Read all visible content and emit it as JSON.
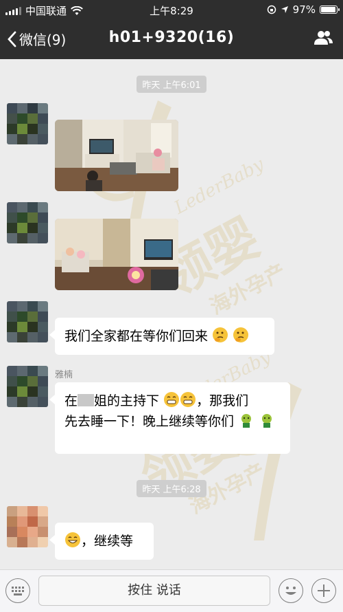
{
  "status_bar": {
    "carrier": "中国联通",
    "time": "上午8:29",
    "battery_label": "97%",
    "battery_level": 0.97
  },
  "nav": {
    "back_label": "微信(9)",
    "title": "h01+9320(16)"
  },
  "timestamps": [
    "昨天 上午6:01",
    "昨天 上午6:28"
  ],
  "messages": [
    {
      "sender": "",
      "type": "image"
    },
    {
      "sender": "",
      "type": "image"
    },
    {
      "sender": "",
      "type": "text",
      "text": "我们全家都在等你们回来"
    },
    {
      "sender": "雅楠",
      "type": "text",
      "line1_a": "在",
      "line1_b": "姐的主持下",
      "line1_c": "，那我们",
      "line2": "先去睡一下！晚上继续等你们"
    },
    {
      "sender": "",
      "type": "text",
      "text": "，继续等"
    }
  ],
  "input_bar": {
    "hold_to_talk": "按住 说话"
  },
  "watermark": {
    "cn_large": "领婴",
    "cn_small": "海外孕产",
    "en": "LederBaby"
  },
  "colors": {
    "header_bg": "#2e2e2e",
    "chat_bg": "#ececec",
    "bubble_bg": "#ffffff",
    "watermark": "#c9a23a"
  },
  "icons": [
    "signal-icon",
    "wifi-icon",
    "lock-rotation-icon",
    "location-icon",
    "battery-icon",
    "back-chevron-icon",
    "group-people-icon",
    "keyboard-icon",
    "emoji-icon",
    "plus-icon",
    "thinking-face-icon",
    "grin-face-icon",
    "plant-icon",
    "smile-face-icon"
  ]
}
